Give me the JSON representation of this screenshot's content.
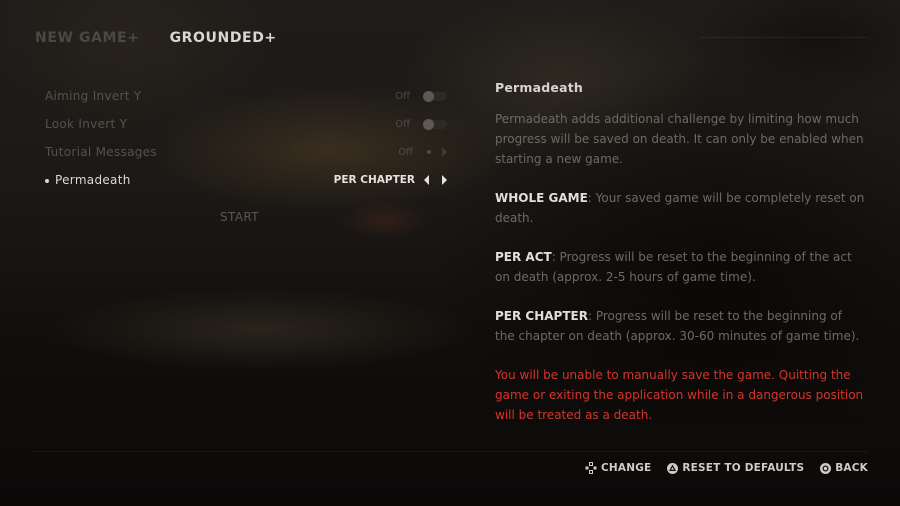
{
  "tabs": [
    {
      "label": "NEW GAME+",
      "active": false
    },
    {
      "label": "GROUNDED+",
      "active": true
    }
  ],
  "settings": [
    {
      "label": "Aiming Invert Y",
      "value": "Off",
      "control": "toggle",
      "state": "off"
    },
    {
      "label": "Look Invert Y",
      "value": "Off",
      "control": "toggle",
      "state": "off"
    },
    {
      "label": "Tutorial Messages",
      "value": "Off",
      "control": "selector"
    },
    {
      "label": "Permadeath",
      "value": "PER CHAPTER",
      "control": "selector",
      "selected": true
    }
  ],
  "start_label": "START",
  "description": {
    "title": "Permadeath",
    "intro": "Permadeath adds additional challenge by limiting how much progress will be saved on death. It can only be enabled when starting a new game.",
    "options": [
      {
        "name": "WHOLE GAME",
        "text": ": Your saved game will be completely reset on death."
      },
      {
        "name": "PER ACT",
        "text": ": Progress will be reset to the beginning of the act on death (approx. 2-5 hours of game time)."
      },
      {
        "name": "PER CHAPTER",
        "text": ": Progress will be reset to the beginning of the chapter on death (approx. 30-60 minutes of game time)."
      }
    ],
    "warning": "You will be unable to manually save the game. Quitting the game or exiting the application while in a dangerous position will be treated as a death."
  },
  "hints": [
    {
      "icon": "dpad-icon",
      "label": "CHANGE"
    },
    {
      "icon": "triangle-button-icon",
      "label": "RESET TO DEFAULTS"
    },
    {
      "icon": "circle-button-icon",
      "label": "BACK"
    }
  ],
  "colors": {
    "warning": "#d5342b",
    "active_text": "#d9d7d2",
    "inactive_text": "#4a4844"
  }
}
